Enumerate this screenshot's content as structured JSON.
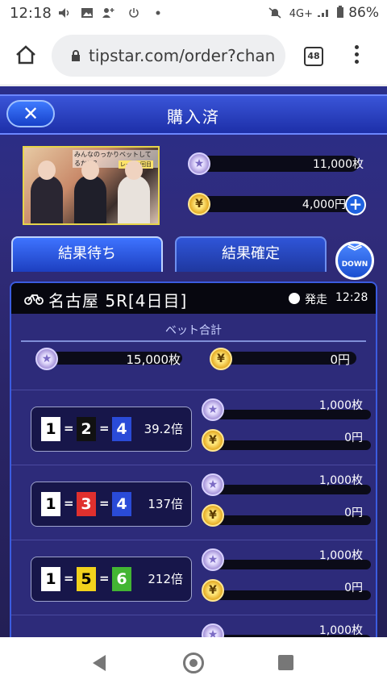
{
  "status_bar": {
    "time": "12:18",
    "network": "4G+",
    "battery": "86%"
  },
  "browser": {
    "url": "tipstar.com/order?chan",
    "tab_count": "48"
  },
  "header": {
    "close_label": "✕",
    "title": "購入済"
  },
  "promo": {
    "caption": "みんなのっかりベットしてるかい？",
    "tag": "レース2回目"
  },
  "balances": {
    "points": "11,000枚",
    "yen": "4,000円",
    "plus_label": "+"
  },
  "tabs": [
    {
      "label": "結果待ち",
      "active": true
    },
    {
      "label": "結果確定",
      "active": false
    }
  ],
  "down_button": {
    "label": "DOWN"
  },
  "race": {
    "name": "名古屋 5R[4日目]",
    "start_label": "発走",
    "start_time": "12:28"
  },
  "bet_total": {
    "label": "ベット合計",
    "points": "15,000枚",
    "yen": "0円"
  },
  "bets": [
    {
      "nums": [
        "1",
        "2",
        "4"
      ],
      "colors": [
        "#ffffff",
        "#111111",
        "#2a4bd8"
      ],
      "text_colors": [
        "#000000",
        "#ffffff",
        "#ffffff"
      ],
      "odds": "39.2倍",
      "points": "1,000枚",
      "yen": "0円"
    },
    {
      "nums": [
        "1",
        "3",
        "4"
      ],
      "colors": [
        "#ffffff",
        "#e0302e",
        "#2a4bd8"
      ],
      "text_colors": [
        "#000000",
        "#ffffff",
        "#ffffff"
      ],
      "odds": "137倍",
      "points": "1,000枚",
      "yen": "0円"
    },
    {
      "nums": [
        "1",
        "5",
        "6"
      ],
      "colors": [
        "#ffffff",
        "#f2d21c",
        "#43b533"
      ],
      "text_colors": [
        "#000000",
        "#000000",
        "#ffffff"
      ],
      "odds": "212倍",
      "points": "1,000枚",
      "yen": "0円"
    },
    {
      "nums": [],
      "colors": [],
      "text_colors": [],
      "odds": "",
      "points": "1,000枚",
      "yen": ""
    }
  ],
  "icons": {
    "point_coin": "star-coin-icon",
    "yen_coin": "yen-coin-icon"
  },
  "colors": {
    "accent": "#1e62e0",
    "gold": "#e6d44a"
  }
}
